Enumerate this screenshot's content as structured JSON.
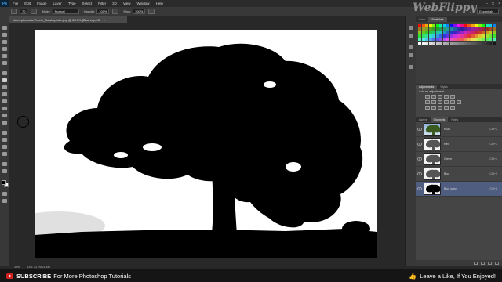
{
  "menubar": {
    "logo": "Ps",
    "items": [
      "File",
      "Edit",
      "Image",
      "Layer",
      "Type",
      "Select",
      "Filter",
      "3D",
      "View",
      "Window",
      "Help"
    ]
  },
  "options": {
    "size": "70",
    "mode_label": "Mode:",
    "mode_value": "Normal",
    "opacity_label": "Opacity:",
    "opacity_value": "100%",
    "flow_label": "Flow:",
    "flow_value": "100%",
    "workspace": "Essentials"
  },
  "document": {
    "tab_title": "video-photos-tr/Tree/tr_0s simplisim.jpg @ 33.3% (Blue copy/8)",
    "close_glyph": "×"
  },
  "status": {
    "zoom": "33%",
    "doc_size": "Doc: 24.7M/28.6M"
  },
  "panels": {
    "swatch_tabs": [
      "Color",
      "Swatches"
    ],
    "adj_tabs": [
      "Adjustments",
      "Styles"
    ],
    "adj_title": "Add an adjustment",
    "layer_tabs": [
      "Layers",
      "Channels",
      "Paths"
    ],
    "channels": [
      {
        "name": "RGB",
        "shortcut": "Ctrl+2",
        "selected": false
      },
      {
        "name": "Red",
        "shortcut": "Ctrl+3",
        "selected": false
      },
      {
        "name": "Green",
        "shortcut": "Ctrl+4",
        "selected": false
      },
      {
        "name": "Blue",
        "shortcut": "Ctrl+5",
        "selected": false
      },
      {
        "name": "Blue copy",
        "shortcut": "Ctrl+6",
        "selected": true
      }
    ]
  },
  "banner": {
    "subscribe": "SUBSCRIBE",
    "subscribe_rest": "For More Photoshop Tutorials",
    "like_text": "Leave a Like, If You Enjoyed!"
  },
  "watermark": "WebFlippy",
  "colors": {
    "selection": "#4f5d80",
    "youtube_red": "#d32020"
  }
}
